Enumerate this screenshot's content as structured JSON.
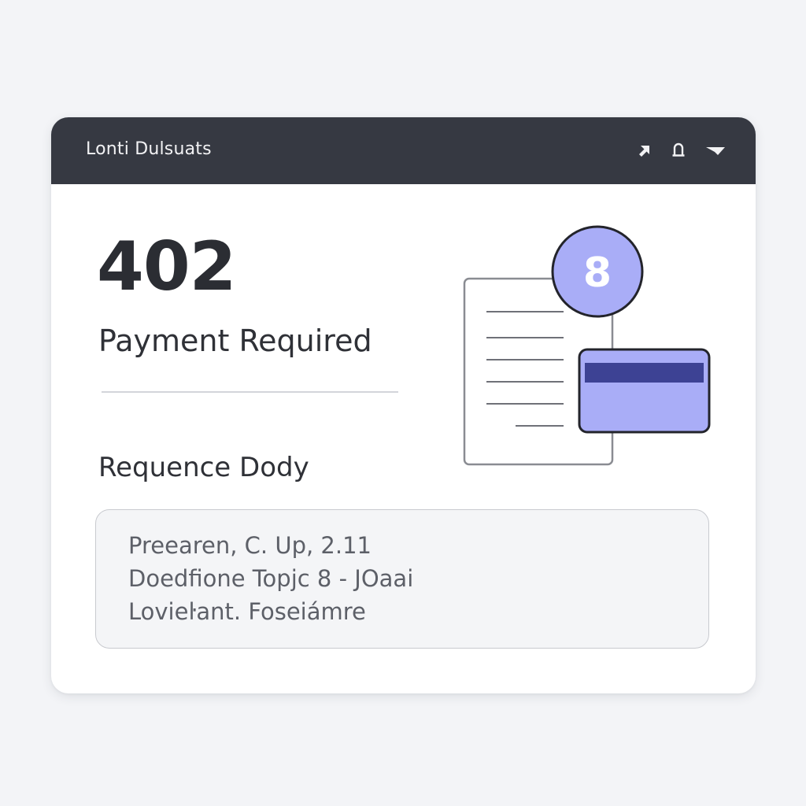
{
  "window": {
    "title": "Lonti Dulsuats"
  },
  "toolbar": {
    "icons": [
      "pin-icon",
      "bell-icon",
      "menu-icon"
    ]
  },
  "error": {
    "code": "402",
    "message": "Payment Required"
  },
  "request_body": {
    "title": "Requence Dody",
    "lines": [
      "Preearen, C. Up, 2.11",
      "Doedfione Topjc 8 - JOaai",
      "Lovieŀant. Foseiámre"
    ]
  },
  "illustration": {
    "badge_text": "8",
    "icons": [
      "document-icon",
      "credit-card-icon",
      "badge-icon"
    ]
  },
  "colors": {
    "titlebar": "#363942",
    "background": "#f3f4f7",
    "accent_light": "#a9adf7",
    "accent_dark": "#3d4294",
    "text_dark": "#2b2d33"
  }
}
